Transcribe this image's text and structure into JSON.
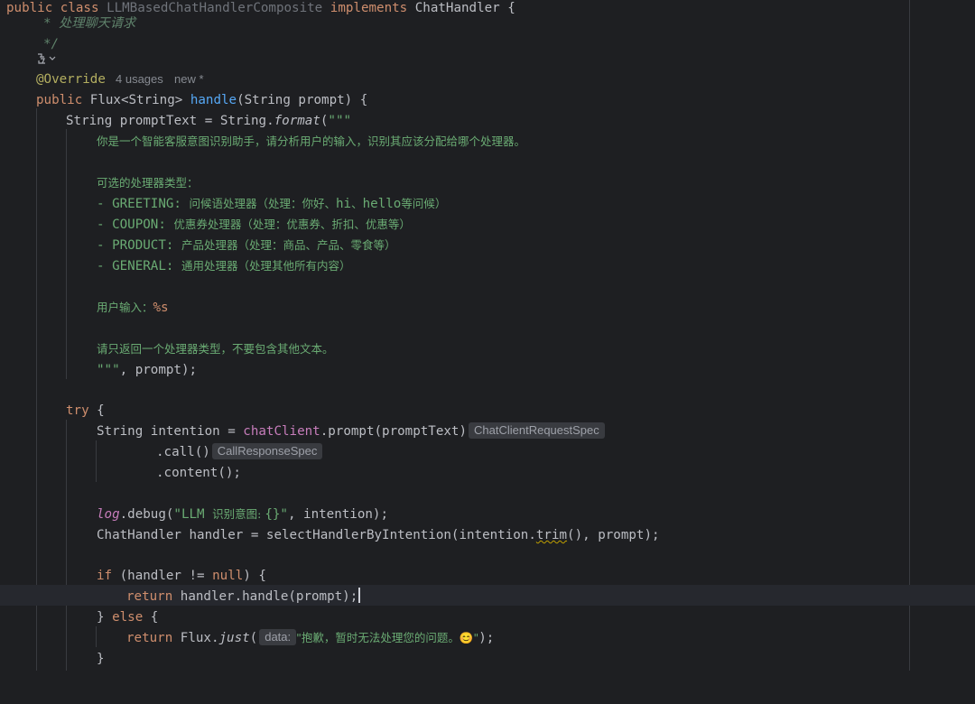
{
  "editor": {
    "class_decl": {
      "public": "public",
      "class": "class",
      "name": "LLMBasedChatHandlerComposite",
      "implements": "implements",
      "iface": "ChatHandler",
      "brace": " {"
    },
    "doc_comment": {
      "line1": "* 处理聊天请求",
      "line2": "*/"
    },
    "gutter_icon": "override-marker-icon",
    "annotation": {
      "name": "@Override",
      "usages": "4 usages",
      "status": "new *"
    },
    "method_sig": {
      "public": "public",
      "ret": "Flux<String>",
      "name": "handle",
      "params": "(String prompt) {"
    },
    "prompt_decl": {
      "type_name": "String promptText = String.",
      "method": "format",
      "open": "(\"\"\""
    },
    "template": {
      "intro": "你是一个智能客服意图识别助手，请分析用户的输入，识别其应该分配给哪个处理器。",
      "types_header": "可选的处理器类型：",
      "greeting": {
        "key": "- GREETING: ",
        "desc_a": "问候语处理器（处理：你好、",
        "ascii1": "hi",
        "desc_b": "、",
        "ascii2": "hello",
        "desc_c": "等问候）"
      },
      "coupon": {
        "key": "- COUPON: ",
        "desc": "优惠券处理器（处理：优惠券、折扣、优惠等）"
      },
      "product": {
        "key": "- PRODUCT: ",
        "desc": "产品处理器（处理：商品、产品、零食等）"
      },
      "general": {
        "key": "- GENERAL: ",
        "desc": "通用处理器（处理其他所有内容）"
      },
      "user_input_label": "用户输入：",
      "user_input_fmt": "%s",
      "closing_instruction": "请只返回一个处理器类型，不要包含其他文本。",
      "close_quotes": "\"\"\"",
      "close_args": ", prompt);"
    },
    "try_block": {
      "try": "try",
      "brace": " {",
      "intention_pre": "String intention = ",
      "chat_client": "chatClient",
      "prompt_call": ".prompt(promptText)",
      "hint_request_spec": "ChatClientRequestSpec",
      "call": ".call()",
      "hint_response_spec": "CallResponseSpec",
      "content": ".content();",
      "log": "log",
      "debug_call": ".debug(",
      "debug_str_a": "\"LLM ",
      "debug_str_cjk": "识别意图: ",
      "debug_str_b": "{}\"",
      "debug_args": ", intention);",
      "handler_line_a": "ChatHandler handler = selectHandlerByIntention(intention.",
      "trim": "trim",
      "handler_line_b": "(), prompt);",
      "if_kw": "if",
      "if_cond_a": " (handler != ",
      "null_kw": "null",
      "if_cond_b": ") {",
      "return_kw": "return",
      "return_expr": " handler.handle(prompt);",
      "else_a": "} ",
      "else_kw": "else",
      "else_b": " {",
      "flux": " Flux.",
      "just": "just",
      "paren_open": "(",
      "hint_data": "data:",
      "fallback_str": "\"抱歉，暂时无法处理您的问题。😊\"",
      "fallback_end": ");",
      "close_brace": "}"
    }
  }
}
